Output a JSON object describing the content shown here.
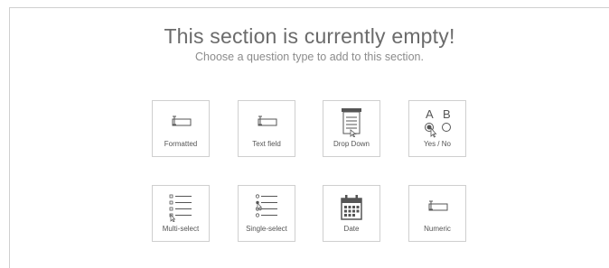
{
  "empty_state": {
    "title": "This section is currently empty!",
    "subtitle": "Choose a question type to add to this section."
  },
  "question_types": [
    {
      "label": "Formatted",
      "icon": "text-input-icon"
    },
    {
      "label": "Text field",
      "icon": "text-input-icon"
    },
    {
      "label": "Drop Down",
      "icon": "dropdown-list-icon"
    },
    {
      "label": "Yes / No",
      "icon": "radio-choice-icon",
      "icon_text_a": "A",
      "icon_text_b": "B"
    },
    {
      "label": "Multi-select",
      "icon": "checkbox-list-icon"
    },
    {
      "label": "Single-select",
      "icon": "radio-list-icon"
    },
    {
      "label": "Date",
      "icon": "calendar-icon"
    },
    {
      "label": "Numeric",
      "icon": "text-input-icon"
    }
  ],
  "colors": {
    "card_border": "#cfcfcf",
    "title": "#6b6b6b",
    "subtitle": "#8c8c8c",
    "icon": "#555555"
  }
}
